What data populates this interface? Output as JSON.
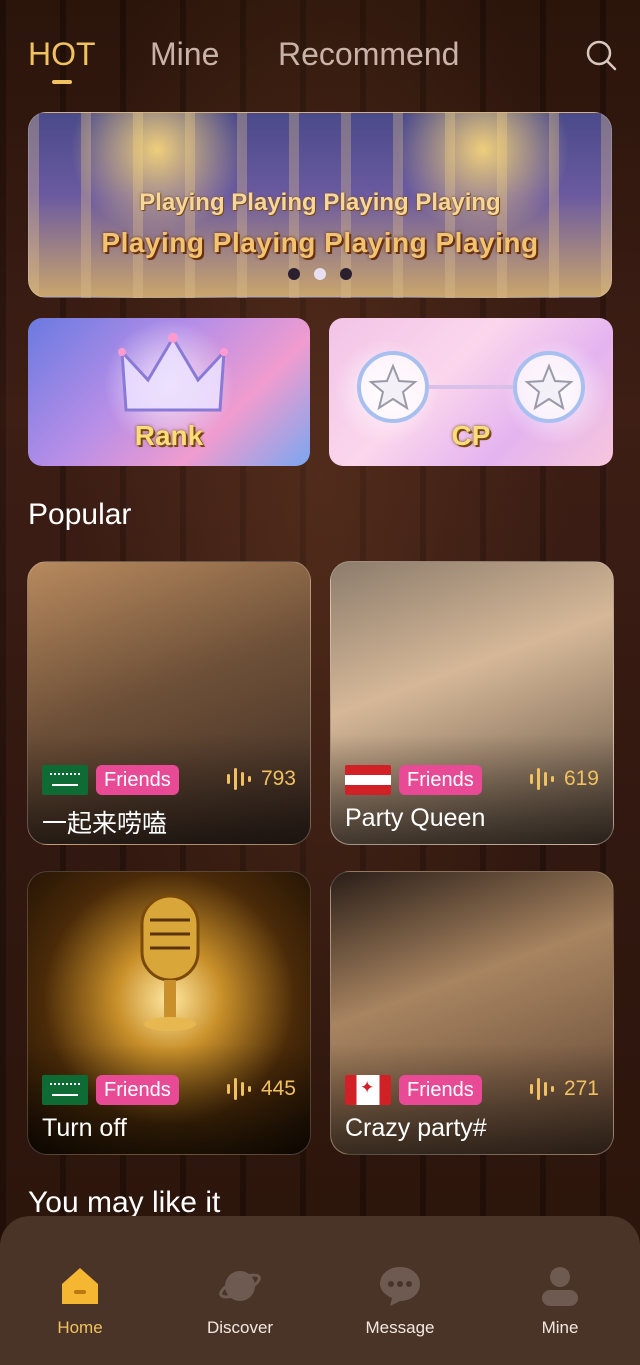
{
  "tabs": [
    {
      "label": "HOT",
      "active": true
    },
    {
      "label": "Mine",
      "active": false
    },
    {
      "label": "Recommend",
      "active": false
    }
  ],
  "banner": {
    "line1": "Playing Playing Playing  Playing",
    "line2": "Playing Playing Playing  Playing",
    "slides": 3,
    "active_slide": 2
  },
  "features": {
    "rank_label": "Rank",
    "cp_label": "CP"
  },
  "popular": {
    "title": "Popular",
    "rooms": [
      {
        "flag": "saudi-arabia",
        "tag": "Friends",
        "count": "793",
        "name": "一起来唠嗑"
      },
      {
        "flag": "austria",
        "tag": "Friends",
        "count": "619",
        "name": "Party Queen"
      },
      {
        "flag": "saudi-arabia",
        "tag": "Friends",
        "count": "445",
        "name": "Turn off"
      },
      {
        "flag": "canada",
        "tag": "Friends",
        "count": "271",
        "name": "Crazy party#"
      }
    ]
  },
  "may_like": {
    "title": "You may like it"
  },
  "bottom_nav": [
    {
      "label": "Home",
      "icon": "home-icon",
      "active": true
    },
    {
      "label": "Discover",
      "icon": "planet-icon",
      "active": false
    },
    {
      "label": "Message",
      "icon": "chat-bubble-icon",
      "active": false
    },
    {
      "label": "Mine",
      "icon": "person-icon",
      "active": false
    }
  ],
  "colors": {
    "accent": "#f0c260",
    "tag_pink": "#e84a96",
    "nav_bg": "#4a3428"
  }
}
